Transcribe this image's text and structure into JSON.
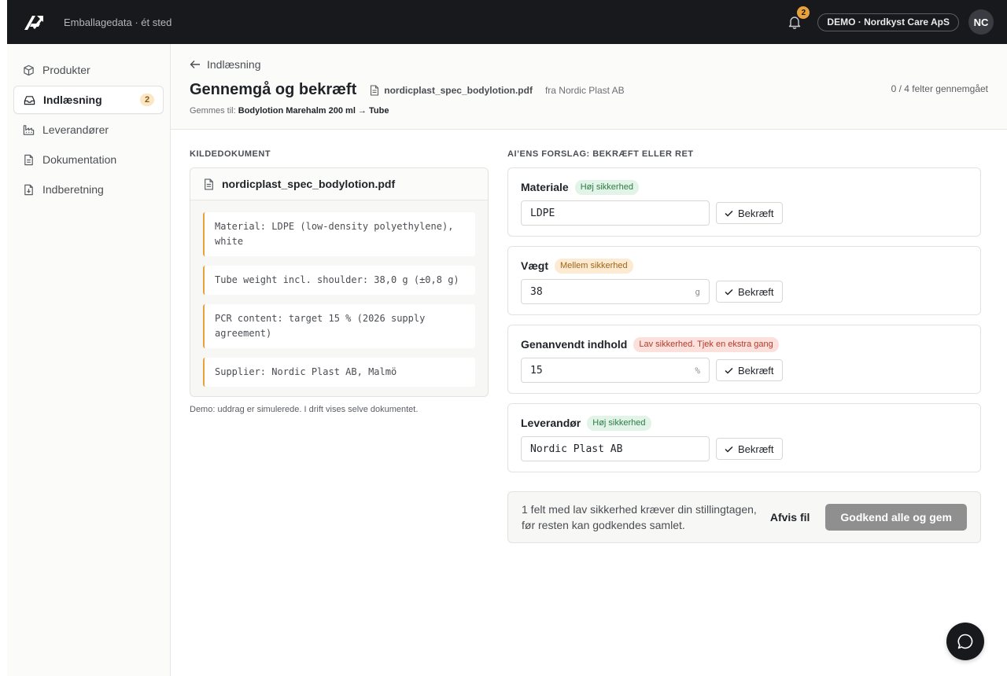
{
  "topbar": {
    "logo_icon": "brand-logo-icon",
    "subtitle": "Emballagedata · ét sted",
    "notifications_count": "2",
    "org_label": "DEMO · Nordkyst Care ApS",
    "avatar_initials": "NC"
  },
  "sidebar": {
    "items": [
      {
        "label": "Produkter",
        "icon": "box-icon"
      },
      {
        "label": "Indlæsning",
        "icon": "inbox-icon",
        "badge": "2",
        "active": true
      },
      {
        "label": "Leverandører",
        "icon": "factory-icon"
      },
      {
        "label": "Dokumentation",
        "icon": "document-icon"
      },
      {
        "label": "Indberetning",
        "icon": "file-download-icon"
      }
    ]
  },
  "header": {
    "back_label": "Indlæsning",
    "title": "Gennemgå og bekræft",
    "file_name": "nordicplast_spec_bodylotion.pdf",
    "from_label": "fra Nordic Plast AB",
    "progress": "0 / 4 felter gennemgået",
    "saves_prefix": "Gemmes til:",
    "saves_target": "Bodylotion Marehalm 200 ml → Tube"
  },
  "source": {
    "section_label": "KILDEDOKUMENT",
    "file_name": "nordicplast_spec_bodylotion.pdf",
    "excerpts": [
      "Material: LDPE (low-density polyethylene), white",
      "Tube weight incl. shoulder: 38,0 g (±0,8 g)",
      "PCR content: target 15 % (2026 supply agreement)",
      "Supplier: Nordic Plast AB, Malmö"
    ],
    "demo_note": "Demo: uddrag er simulerede. I drift vises selve dokumentet."
  },
  "suggestions": {
    "section_label": "AI’ENS FORSLAG: BEKRÆFT ELLER RET",
    "confirm_label": "Bekræft",
    "fields": [
      {
        "name": "Materiale",
        "confidence": "Høj sikkerhed",
        "level": "high",
        "value": "LDPE",
        "unit": ""
      },
      {
        "name": "Vægt",
        "confidence": "Mellem sikkerhed",
        "level": "mid",
        "value": "38",
        "unit": "g"
      },
      {
        "name": "Genanvendt indhold",
        "confidence": "Lav sikkerhed. Tjek en ekstra gang",
        "level": "low",
        "value": "15",
        "unit": "%"
      },
      {
        "name": "Leverandør",
        "confidence": "Høj sikkerhed",
        "level": "high",
        "value": "Nordic Plast AB",
        "unit": ""
      }
    ]
  },
  "footer": {
    "message": "1 felt med lav sikkerhed kræver din stillingtagen, før resten kan godkendes samlet.",
    "reject_label": "Afvis fil",
    "approve_label": "Godkend alle og gem"
  },
  "colors": {
    "topbar": "#18191c",
    "accent": "#e9a23b",
    "high": "#2f7a45",
    "mid": "#a16415",
    "low": "#b53a2b",
    "approve_disabled": "#8f8f8f"
  }
}
